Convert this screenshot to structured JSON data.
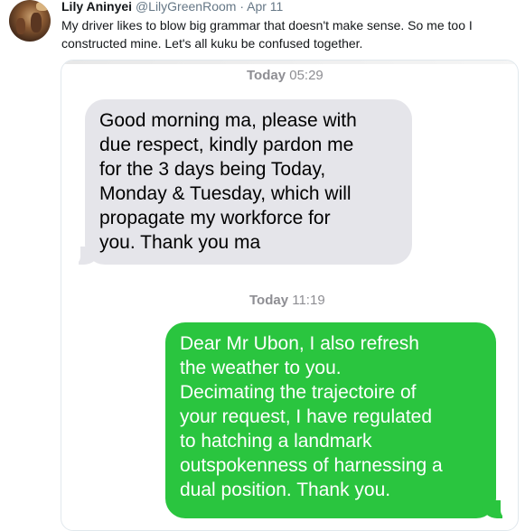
{
  "tweet": {
    "author_name": "Lily Aninyei",
    "author_handle": "@LilyGreenRoom",
    "separator": "·",
    "date": "Apr 11",
    "text_lines": [
      "My driver likes to blow big grammar that doesn't make sense. So me too I",
      "constructed mine. Let's all kuku be confused together."
    ]
  },
  "conversation": {
    "messages": [
      {
        "timestamp_day": "Today",
        "timestamp_time": "05:29",
        "direction": "incoming",
        "lines": [
          "Good morning ma, please with",
          "due respect, kindly pardon me",
          "for the 3 days being Today,",
          "Monday & Tuesday, which will",
          "propagate my workforce for",
          "you. Thank you ma"
        ]
      },
      {
        "timestamp_day": "Today",
        "timestamp_time": "11:19",
        "direction": "outgoing",
        "lines": [
          "Dear Mr Ubon, I also refresh",
          "the weather to you.",
          "Decimating the trajectoire of",
          "your request, I have regulated",
          "to hatching a landmark",
          "outspokenness of harnessing a",
          "dual position. Thank you."
        ]
      }
    ]
  },
  "colors": {
    "incoming_bubble": "#e5e5ea",
    "outgoing_bubble": "#2ac53f",
    "timestamp": "#8e8e93",
    "handle": "#657786"
  },
  "icons": {
    "avatar": "profile-photo"
  }
}
